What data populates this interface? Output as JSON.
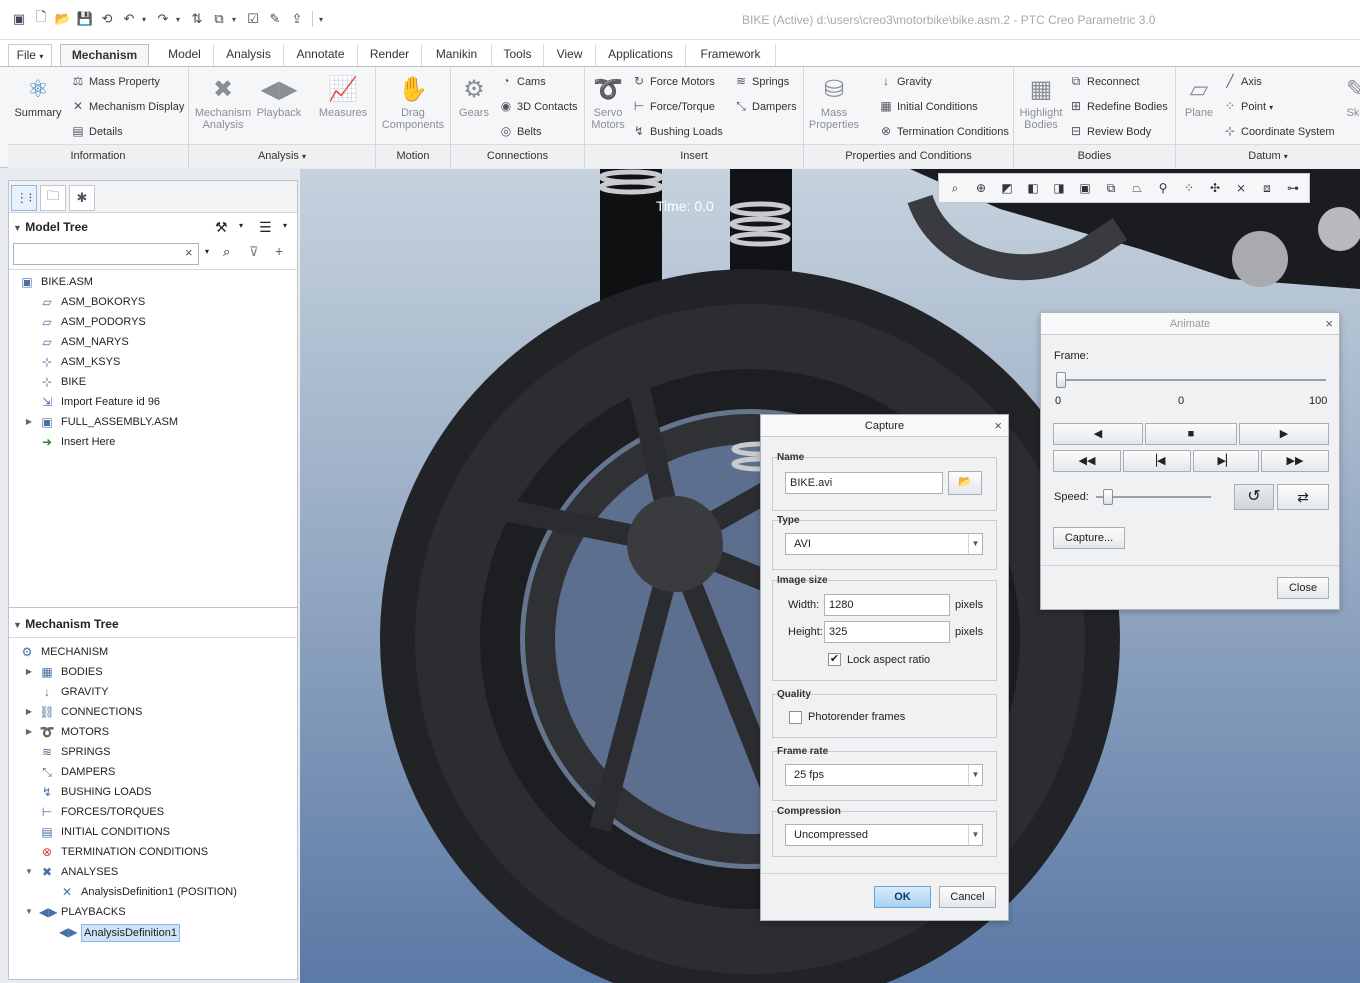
{
  "window": {
    "title": "BIKE (Active) d:\\users\\creo3\\motorbike\\bike.asm.2 - PTC Creo Parametric 3.0"
  },
  "ribbon_tabs": {
    "file": "File",
    "mechanism": "Mechanism",
    "model": "Model",
    "analysis": "Analysis",
    "annotate": "Annotate",
    "render": "Render",
    "manikin": "Manikin",
    "tools": "Tools",
    "view": "View",
    "applications": "Applications",
    "framework": "Framework"
  },
  "ribbon": {
    "information": {
      "label": "Information",
      "summary": "Summary",
      "mass_property": "Mass Property",
      "mechanism_display": "Mechanism Display",
      "details": "Details"
    },
    "analysis": {
      "label": "Analysis",
      "mechanism_analysis_1": "Mechanism",
      "mechanism_analysis_2": "Analysis",
      "playback": "Playback",
      "measures": "Measures"
    },
    "motion": {
      "label": "Motion",
      "drag_1": "Drag",
      "drag_2": "Components"
    },
    "connections": {
      "label": "Connections",
      "gears": "Gears",
      "cams": "Cams",
      "contacts": "3D Contacts",
      "belts": "Belts"
    },
    "insert": {
      "label": "Insert",
      "servo_1": "Servo",
      "servo_2": "Motors",
      "force_motors": "Force Motors",
      "force_torque": "Force/Torque",
      "bushing_loads": "Bushing Loads",
      "springs": "Springs",
      "dampers": "Dampers"
    },
    "properties": {
      "label": "Properties and Conditions",
      "mass_1": "Mass",
      "mass_2": "Properties",
      "gravity": "Gravity",
      "initial_conditions": "Initial Conditions",
      "termination_conditions": "Termination Conditions"
    },
    "bodies": {
      "label": "Bodies",
      "highlight_1": "Highlight",
      "highlight_2": "Bodies",
      "reconnect": "Reconnect",
      "redefine_bodies": "Redefine Bodies",
      "review_body": "Review Body"
    },
    "datum": {
      "label": "Datum",
      "plane": "Plane",
      "axis": "Axis",
      "point": "Point",
      "coordinate_system": "Coordinate System",
      "sketch": "Ske"
    }
  },
  "model_tree": {
    "title": "Model Tree",
    "search_value": "",
    "items": [
      {
        "label": "BIKE.ASM",
        "icon": "assembly-icon"
      },
      {
        "label": "ASM_BOKORYS",
        "icon": "datum-plane-icon"
      },
      {
        "label": "ASM_PODORYS",
        "icon": "datum-plane-icon"
      },
      {
        "label": "ASM_NARYS",
        "icon": "datum-plane-icon"
      },
      {
        "label": "ASM_KSYS",
        "icon": "coordinate-system-icon"
      },
      {
        "label": "BIKE",
        "icon": "coordinate-system-icon"
      },
      {
        "label": "Import Feature id 96",
        "icon": "import-feature-icon"
      },
      {
        "label": "FULL_ASSEMBLY.ASM",
        "icon": "assembly-icon"
      },
      {
        "label": "Insert Here",
        "icon": "insert-arrow-icon"
      }
    ]
  },
  "mechanism_tree": {
    "title": "Mechanism Tree",
    "items": [
      {
        "label": "MECHANISM",
        "icon": "mechanism-icon"
      },
      {
        "label": "BODIES",
        "icon": "bodies-icon"
      },
      {
        "label": "GRAVITY",
        "icon": "gravity-icon"
      },
      {
        "label": "CONNECTIONS",
        "icon": "connections-icon"
      },
      {
        "label": "MOTORS",
        "icon": "motors-icon"
      },
      {
        "label": "SPRINGS",
        "icon": "springs-icon"
      },
      {
        "label": "DAMPERS",
        "icon": "dampers-icon"
      },
      {
        "label": "BUSHING LOADS",
        "icon": "bushing-loads-icon"
      },
      {
        "label": "FORCES/TORQUES",
        "icon": "forces-icon"
      },
      {
        "label": "INITIAL CONDITIONS",
        "icon": "initial-conditions-icon"
      },
      {
        "label": "TERMINATION CONDITIONS",
        "icon": "termination-icon"
      },
      {
        "label": "ANALYSES",
        "icon": "analyses-icon"
      },
      {
        "label": "AnalysisDefinition1 (POSITION)",
        "icon": "analysis-definition-icon"
      },
      {
        "label": "PLAYBACKS",
        "icon": "playbacks-icon"
      },
      {
        "label": "AnalysisDefinition1",
        "icon": "playback-item-icon"
      }
    ]
  },
  "viewport": {
    "time_label": "Time: 0.0"
  },
  "animate": {
    "title": "Animate",
    "frame_label": "Frame:",
    "frame_min": "0",
    "frame_current": "0",
    "frame_max": "100",
    "frame_fraction": 0.0,
    "speed_label": "Speed:",
    "speed_fraction": 0.07,
    "capture_button": "Capture...",
    "close_button": "Close"
  },
  "capture": {
    "title": "Capture",
    "name_legend": "Name",
    "name_value": "BIKE.avi",
    "type_legend": "Type",
    "type_value": "AVI",
    "image_size_legend": "Image size",
    "width_label": "Width:",
    "width_value": "1280",
    "height_label": "Height:",
    "height_value": "325",
    "pixels_unit": "pixels",
    "lock_aspect": "Lock aspect ratio",
    "lock_aspect_checked": true,
    "quality_legend": "Quality",
    "photorender": "Photorender frames",
    "photorender_checked": false,
    "frame_rate_legend": "Frame rate",
    "frame_rate_value": "25 fps",
    "compression_legend": "Compression",
    "compression_value": "Uncompressed",
    "ok_button": "OK",
    "cancel_button": "Cancel"
  }
}
